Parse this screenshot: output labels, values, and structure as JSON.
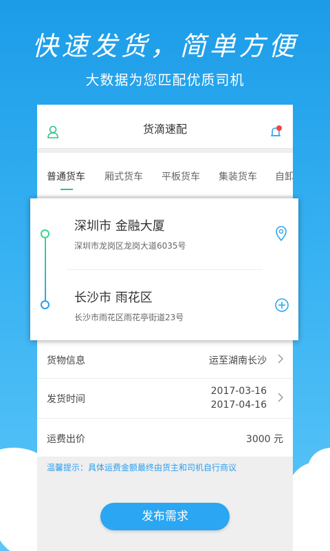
{
  "promo": {
    "headline": "快速发货，简单方便",
    "subline": "大数据为您匹配优质司机"
  },
  "app": {
    "title": "货滴速配"
  },
  "tabs": [
    {
      "label": "普通货车",
      "active": true
    },
    {
      "label": "厢式货车",
      "active": false
    },
    {
      "label": "平板货车",
      "active": false
    },
    {
      "label": "集装货车",
      "active": false
    },
    {
      "label": "自卸",
      "active": false
    }
  ],
  "route": {
    "from": {
      "city": "深圳市  金融大厦",
      "address": "深圳市龙岗区龙岗大道6035号"
    },
    "to": {
      "city": "长沙市  雨花区",
      "address": "长沙市雨花区雨花亭街道23号"
    }
  },
  "form": {
    "cargo_label": "货物信息",
    "cargo_value": "运至湖南长沙",
    "time_label": "发货时间",
    "time_start": "2017-03-16",
    "time_end": "2017-04-16",
    "price_label": "运费出价",
    "price_value": "3000 元"
  },
  "tip": "温馨提示：具体运费金额最终由货主和司机自行商议",
  "publish_label": "发布需求",
  "colors": {
    "accent_green": "#27c387",
    "accent_blue": "#2aa6f2",
    "notify_red": "#f04444"
  }
}
